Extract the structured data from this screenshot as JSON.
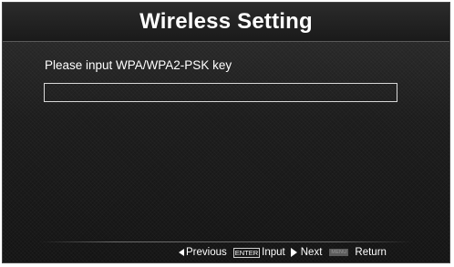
{
  "title": "Wireless Setting",
  "prompt": "Please input WPA/WPA2-PSK key",
  "key_input": {
    "value": "",
    "placeholder": ""
  },
  "footer": {
    "previous_label": "Previous",
    "enter_key_label": "ENTER",
    "input_label": "Input",
    "next_label": "Next",
    "menu_key_label": "MENU",
    "return_label": "Return"
  },
  "icons": {
    "previous": "left-triangle-icon",
    "enter": "enter-key-icon",
    "next": "right-triangle-icon",
    "menu": "menu-key-icon"
  },
  "colors": {
    "background": "#1c1c1c",
    "text": "#ffffff",
    "input_border": "#d8d8d8"
  }
}
